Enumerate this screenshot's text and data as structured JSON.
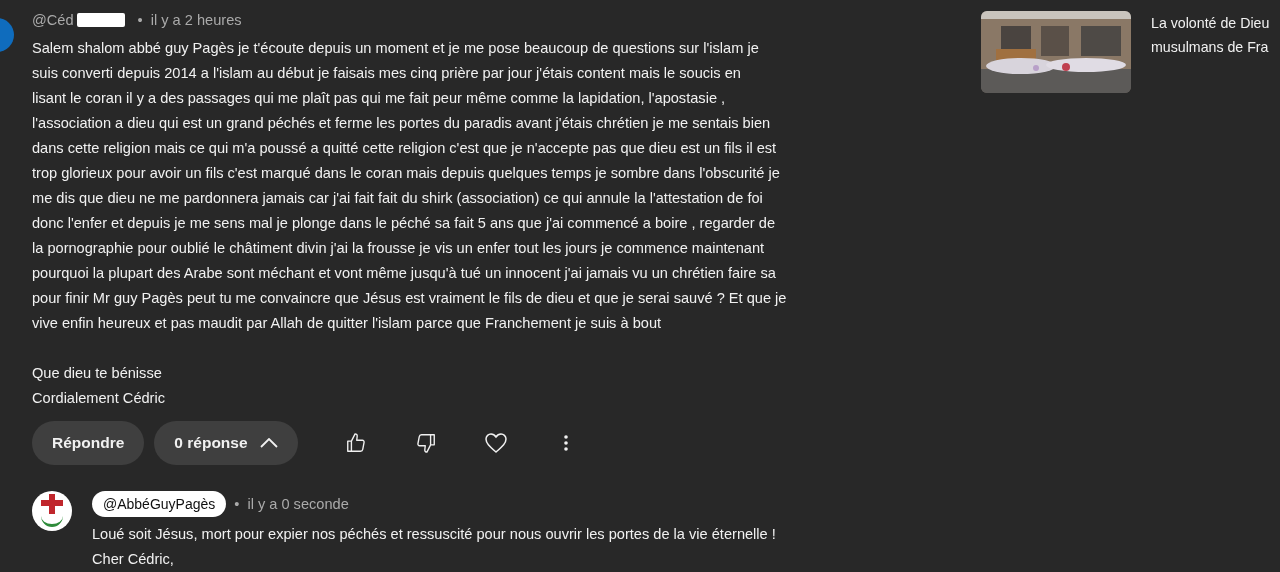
{
  "comment": {
    "author": "@Céd",
    "redacted": true,
    "separator": "•",
    "time": "il y a 2 heures",
    "text": "Salem shalom abbé guy Pagès je t'écoute depuis un moment et je me pose beaucoup de questions sur l'islam je\nsuis converti depuis 2014 a l'islam au début je faisais mes cinq prière par jour j'étais content mais le soucis en\nlisant le coran il y a des passages qui me plaît pas qui me fait peur même comme la lapidation, l'apostasie ,\nl'association a dieu qui est un grand péchés et ferme les portes du paradis avant j'étais chrétien je me sentais bien\ndans cette religion mais ce qui m'a poussé a quitté cette religion c'est que je n'accepte pas que dieu est un fils il est\ntrop glorieux pour avoir un fils c'est marqué dans le coran mais depuis quelques temps je sombre dans l'obscurité je\nme dis que dieu ne me pardonnera jamais car j'ai fait fait du shirk (association) ce qui annule la l'attestation de foi\ndonc l'enfer et depuis je me sens mal je plonge dans le péché sa fait 5 ans que j'ai commencé a boire , regarder de\nla pornographie pour oublié le châtiment divin j'ai la frousse je vis un enfer tout les jours je commence maintenant\npourquoi la plupart des Arabe sont méchant et vont même jusqu'à tué un innocent j'ai jamais vu un chrétien faire sa\npour finir Mr guy Pagès peut tu me convaincre que Jésus est vraiment le fils de dieu et que je serai sauvé ? Et que je\nvive enfin heureux et pas maudit par Allah de quitter l'islam parce que Franchement je suis à bout\n\nQue dieu te bénisse\nCordialement Cédric",
    "reply_button": "Répondre",
    "replies_button": "0 réponse",
    "replies_expanded": true
  },
  "reply": {
    "author": "@AbbéGuyPagès",
    "separator": "•",
    "time": "il y a 0 seconde",
    "text": "Loué soit Jésus, mort pour expier nos péchés et ressuscité pour nous ouvrir les portes de la vie éternelle !\nCher Cédric,"
  },
  "related_video": {
    "title": "La volonté de Dieu\nmusulmans de Fra"
  }
}
